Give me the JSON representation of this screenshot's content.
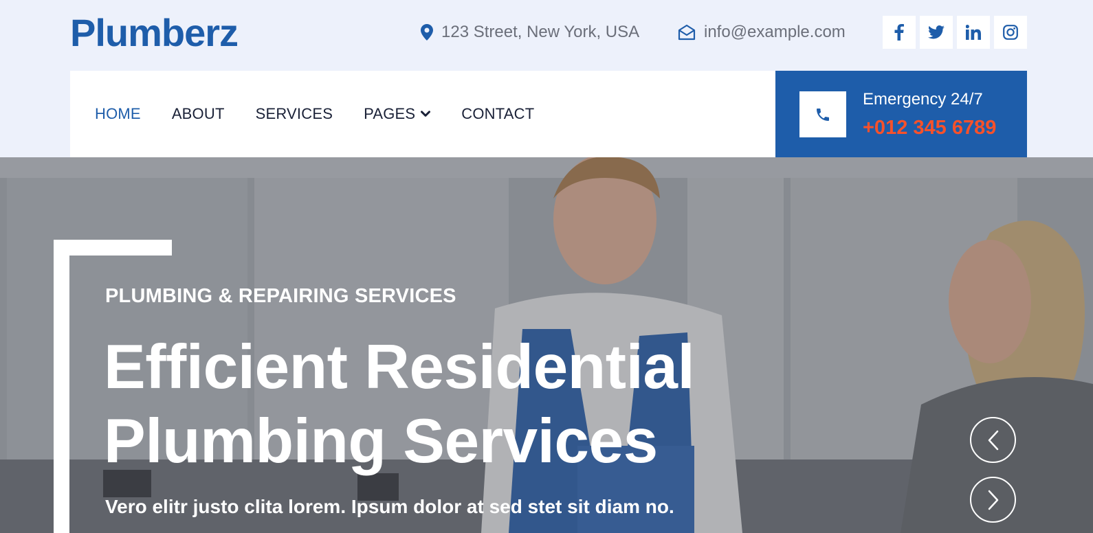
{
  "brand": {
    "logo": "Plumberz"
  },
  "topbar": {
    "address": "123 Street, New York, USA",
    "email": "info@example.com",
    "socials": [
      {
        "icon": "facebook-icon",
        "glyph": "f"
      },
      {
        "icon": "twitter-icon",
        "glyph": "t"
      },
      {
        "icon": "linkedin-icon",
        "glyph": "in"
      },
      {
        "icon": "instagram-icon",
        "glyph": "ig"
      }
    ]
  },
  "nav": {
    "items": [
      {
        "label": "HOME",
        "active": true
      },
      {
        "label": "ABOUT"
      },
      {
        "label": "SERVICES"
      },
      {
        "label": "PAGES",
        "dropdown": true
      },
      {
        "label": "CONTACT"
      }
    ]
  },
  "emergency": {
    "label": "Emergency 24/7",
    "number": "+012 345 6789"
  },
  "hero": {
    "kicker": "PLUMBING & REPAIRING SERVICES",
    "title_line1": "Efficient Residential",
    "title_line2": "Plumbing Services",
    "subtitle": "Vero elitr justo clita lorem. Ipsum dolor at sed stet sit diam no."
  },
  "colors": {
    "primary": "#1e5daa",
    "accent": "#f7512b",
    "topbar_bg": "#edf1fb",
    "nav_text": "#1a2137"
  }
}
